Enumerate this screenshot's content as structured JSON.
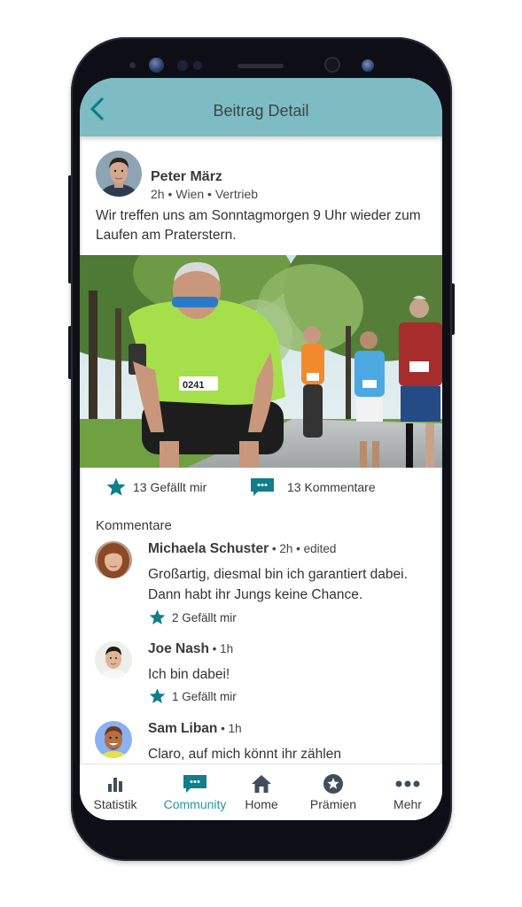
{
  "colors": {
    "header_bg": "#7ebcc4",
    "accent": "#0e7f8b",
    "active_nav": "#2b93a1",
    "text": "#3a3a3a"
  },
  "header": {
    "back_icon": "chevron-left-icon",
    "title": "Beitrag Detail"
  },
  "post": {
    "author": "Peter März",
    "meta": "2h • Wien • Vertrieb",
    "text": "Wir treffen uns am Sonntagmorgen 9 Uhr wieder zum Laufen am Praterstern.",
    "image_description": "Senior runners taking a break in a park",
    "likes_label": "13 Gefällt mir",
    "comments_label": "13 Kommentare"
  },
  "comments": {
    "heading": "Kommentare",
    "items": [
      {
        "name": "Michaela Schuster",
        "meta": " • 2h • edited",
        "text": "Großartig, diesmal bin ich garantiert dabei. Dann habt ihr Jungs keine Chance.",
        "likes_label": "2 Gefällt mir"
      },
      {
        "name": "Joe Nash",
        "meta": " • 1h",
        "text": "Ich bin dabei!",
        "likes_label": "1 Gefällt mir"
      },
      {
        "name": "Sam Liban",
        "meta": " • 1h",
        "text": "Claro, auf mich könnt ihr zählen"
      }
    ]
  },
  "nav": {
    "items": [
      {
        "label": "Statistik",
        "icon": "bar-chart-icon"
      },
      {
        "label": "Community",
        "icon": "chat-bubble-icon",
        "active": true
      },
      {
        "label": "Home",
        "icon": "home-icon"
      },
      {
        "label": "Prämien",
        "icon": "star-circle-icon"
      },
      {
        "label": "Mehr",
        "icon": "more-dots-icon"
      }
    ]
  }
}
